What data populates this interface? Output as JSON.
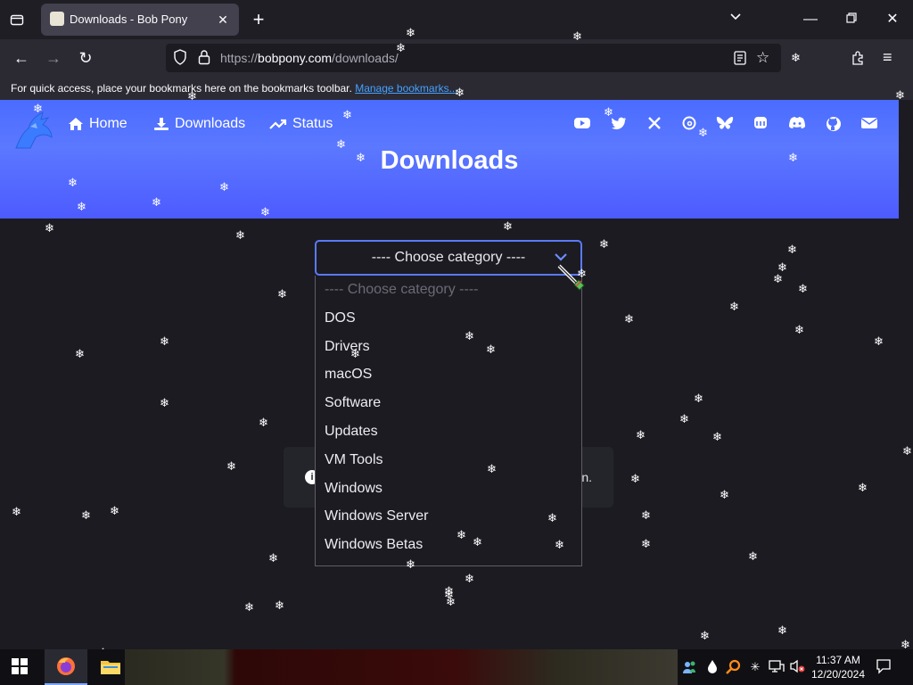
{
  "browser": {
    "tab_title": "Downloads - Bob Pony",
    "url_prefix": "https://",
    "url_host": "bobpony.com",
    "url_path": "/downloads/",
    "bookmarks_message": "For quick access, place your bookmarks here on the bookmarks toolbar.",
    "bookmarks_link": "Manage bookmarks..."
  },
  "site": {
    "nav": [
      {
        "label": "Home",
        "icon": "home-icon"
      },
      {
        "label": "Downloads",
        "icon": "download-icon"
      },
      {
        "label": "Status",
        "icon": "trend-icon"
      }
    ],
    "social": [
      "youtube-icon",
      "twitter-icon",
      "x-icon",
      "threads-icon",
      "bluesky-icon",
      "mastodon-icon",
      "discord-icon",
      "github-icon",
      "mail-icon"
    ],
    "title": "Downloads",
    "accent": "#4a6cff"
  },
  "category_select": {
    "selected": "---- Choose category ----",
    "options": [
      "---- Choose category ----",
      "DOS",
      "Drivers",
      "macOS",
      "Software",
      "Updates",
      "VM Tools",
      "Windows",
      "Windows Server",
      "Windows Betas"
    ]
  },
  "info_box": {
    "tail_text": "n."
  },
  "taskbar": {
    "time": "11:37 AM",
    "date": "12/20/2024"
  }
}
